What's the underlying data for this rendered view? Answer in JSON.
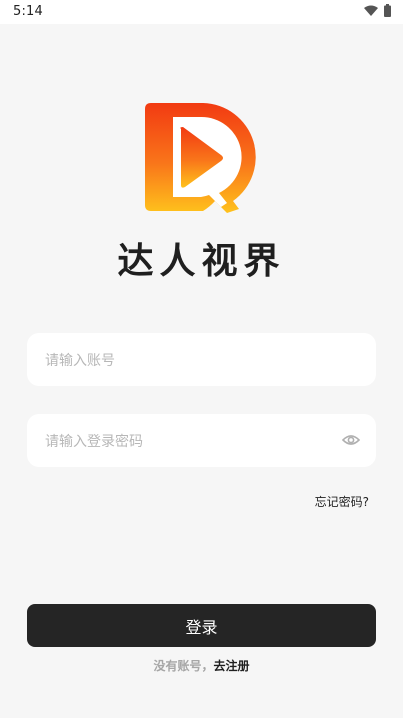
{
  "status_bar": {
    "time": "5:14",
    "icons": [
      "wifi-icon",
      "battery-icon"
    ]
  },
  "brand": {
    "title": "达人视界",
    "logo_icon": "play-d-logo"
  },
  "account_field": {
    "placeholder": "请输入账号",
    "value": ""
  },
  "password_field": {
    "placeholder": "请输入登录密码",
    "value": "",
    "toggle_icon": "eye-icon"
  },
  "forgot_password": "忘记密码?",
  "login_button": "登录",
  "register": {
    "prompt": "没有账号，",
    "link": "去注册"
  },
  "colors": {
    "background": "#f6f6f6",
    "button": "#252525",
    "logo_gradient_top": "#f23a12",
    "logo_gradient_bottom": "#ffc21c"
  }
}
